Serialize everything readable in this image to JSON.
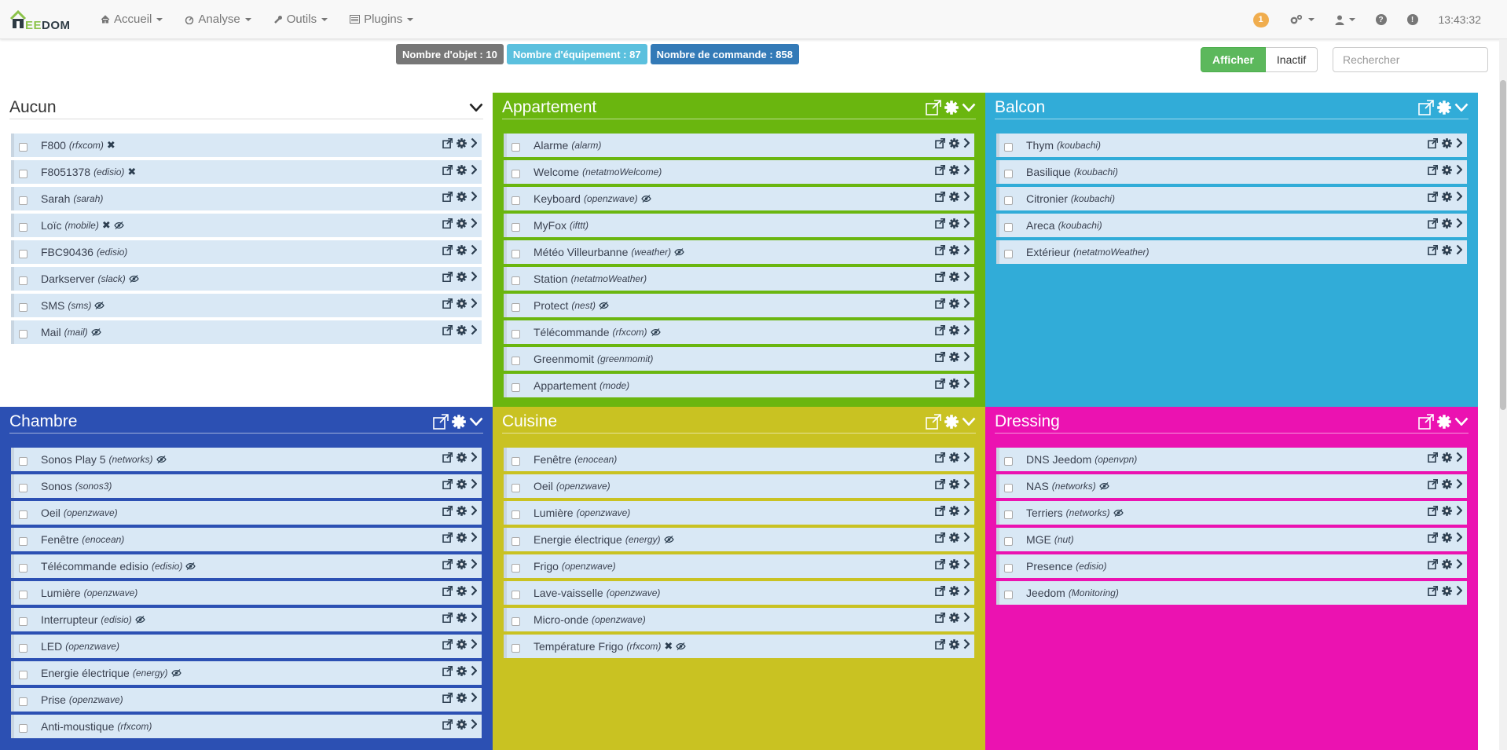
{
  "brand": {
    "text_pre": "i",
    "text_accent": "EE",
    "text_post": "DOM"
  },
  "nav": [
    {
      "label": "Accueil",
      "icon": "home-icon"
    },
    {
      "label": "Analyse",
      "icon": "dashboard-icon"
    },
    {
      "label": "Outils",
      "icon": "wrench-icon"
    },
    {
      "label": "Plugins",
      "icon": "tasks-icon"
    }
  ],
  "nav_right": {
    "badge": "1",
    "time": "13:43:32"
  },
  "counters": {
    "objects": "Nombre d'objet : 10",
    "equipments": "Nombre d'équipement : 87",
    "commands": "Nombre de commande : 858"
  },
  "filter": {
    "show_label": "Afficher",
    "inactive_label": "Inactif",
    "search_placeholder": "Rechercher"
  },
  "colors": {
    "appartement": "#6ab60f",
    "balcon": "#31acd8",
    "chambre": "#2c50b3",
    "cuisine": "#c9c222",
    "dressing": "#eb12b1"
  },
  "objects": {
    "aucun": {
      "name": "Aucun",
      "items": [
        {
          "name": "F800",
          "plugin": "(rfxcom)",
          "x": true,
          "eye": false
        },
        {
          "name": "F8051378",
          "plugin": "(edisio)",
          "x": true,
          "eye": false
        },
        {
          "name": "Sarah",
          "plugin": "(sarah)",
          "x": false,
          "eye": false
        },
        {
          "name": "Loïc",
          "plugin": "(mobile)",
          "x": true,
          "eye": true
        },
        {
          "name": "FBC90436",
          "plugin": "(edisio)",
          "x": false,
          "eye": false
        },
        {
          "name": "Darkserver",
          "plugin": "(slack)",
          "x": false,
          "eye": true
        },
        {
          "name": "SMS",
          "plugin": "(sms)",
          "x": false,
          "eye": true
        },
        {
          "name": "Mail",
          "plugin": "(mail)",
          "x": false,
          "eye": true
        }
      ]
    },
    "appartement": {
      "name": "Appartement",
      "items": [
        {
          "name": "Alarme",
          "plugin": "(alarm)",
          "x": false,
          "eye": false
        },
        {
          "name": "Welcome",
          "plugin": "(netatmoWelcome)",
          "x": false,
          "eye": false
        },
        {
          "name": "Keyboard",
          "plugin": "(openzwave)",
          "x": false,
          "eye": true
        },
        {
          "name": "MyFox",
          "plugin": "(ifttt)",
          "x": false,
          "eye": false
        },
        {
          "name": "Météo Villeurbanne",
          "plugin": "(weather)",
          "x": false,
          "eye": true
        },
        {
          "name": "Station",
          "plugin": "(netatmoWeather)",
          "x": false,
          "eye": false
        },
        {
          "name": "Protect",
          "plugin": "(nest)",
          "x": false,
          "eye": true
        },
        {
          "name": "Télécommande",
          "plugin": "(rfxcom)",
          "x": false,
          "eye": true
        },
        {
          "name": "Greenmomit",
          "plugin": "(greenmomit)",
          "x": false,
          "eye": false
        },
        {
          "name": "Appartement",
          "plugin": "(mode)",
          "x": false,
          "eye": false
        }
      ]
    },
    "balcon": {
      "name": "Balcon",
      "items": [
        {
          "name": "Thym",
          "plugin": "(koubachi)",
          "x": false,
          "eye": false
        },
        {
          "name": "Basilique",
          "plugin": "(koubachi)",
          "x": false,
          "eye": false
        },
        {
          "name": "Citronier",
          "plugin": "(koubachi)",
          "x": false,
          "eye": false
        },
        {
          "name": "Areca",
          "plugin": "(koubachi)",
          "x": false,
          "eye": false
        },
        {
          "name": "Extérieur",
          "plugin": "(netatmoWeather)",
          "x": false,
          "eye": false
        }
      ]
    },
    "chambre": {
      "name": "Chambre",
      "items": [
        {
          "name": "Sonos Play 5",
          "plugin": "(networks)",
          "x": false,
          "eye": true
        },
        {
          "name": "Sonos",
          "plugin": "(sonos3)",
          "x": false,
          "eye": false
        },
        {
          "name": "Oeil",
          "plugin": "(openzwave)",
          "x": false,
          "eye": false
        },
        {
          "name": "Fenêtre",
          "plugin": "(enocean)",
          "x": false,
          "eye": false
        },
        {
          "name": "Télécommande edisio",
          "plugin": "(edisio)",
          "x": false,
          "eye": true
        },
        {
          "name": "Lumière",
          "plugin": "(openzwave)",
          "x": false,
          "eye": false
        },
        {
          "name": "Interrupteur",
          "plugin": "(edisio)",
          "x": false,
          "eye": true
        },
        {
          "name": "LED",
          "plugin": "(openzwave)",
          "x": false,
          "eye": false
        },
        {
          "name": "Energie électrique",
          "plugin": "(energy)",
          "x": false,
          "eye": true
        },
        {
          "name": "Prise",
          "plugin": "(openzwave)",
          "x": false,
          "eye": false
        },
        {
          "name": "Anti-moustique",
          "plugin": "(rfxcom)",
          "x": false,
          "eye": false
        }
      ]
    },
    "cuisine": {
      "name": "Cuisine",
      "items": [
        {
          "name": "Fenêtre",
          "plugin": "(enocean)",
          "x": false,
          "eye": false
        },
        {
          "name": "Oeil",
          "plugin": "(openzwave)",
          "x": false,
          "eye": false
        },
        {
          "name": "Lumière",
          "plugin": "(openzwave)",
          "x": false,
          "eye": false
        },
        {
          "name": "Energie électrique",
          "plugin": "(energy)",
          "x": false,
          "eye": true
        },
        {
          "name": "Frigo",
          "plugin": "(openzwave)",
          "x": false,
          "eye": false
        },
        {
          "name": "Lave-vaisselle",
          "plugin": "(openzwave)",
          "x": false,
          "eye": false
        },
        {
          "name": "Micro-onde",
          "plugin": "(openzwave)",
          "x": false,
          "eye": false
        },
        {
          "name": "Température Frigo",
          "plugin": "(rfxcom)",
          "x": true,
          "eye": true
        }
      ]
    },
    "dressing": {
      "name": "Dressing",
      "items": [
        {
          "name": "DNS Jeedom",
          "plugin": "(openvpn)",
          "x": false,
          "eye": false
        },
        {
          "name": "NAS",
          "plugin": "(networks)",
          "x": false,
          "eye": true
        },
        {
          "name": "Terriers",
          "plugin": "(networks)",
          "x": false,
          "eye": true
        },
        {
          "name": "MGE",
          "plugin": "(nut)",
          "x": false,
          "eye": false
        },
        {
          "name": "Presence",
          "plugin": "(edisio)",
          "x": false,
          "eye": false
        },
        {
          "name": "Jeedom",
          "plugin": "(Monitoring)",
          "x": false,
          "eye": false
        }
      ]
    }
  }
}
